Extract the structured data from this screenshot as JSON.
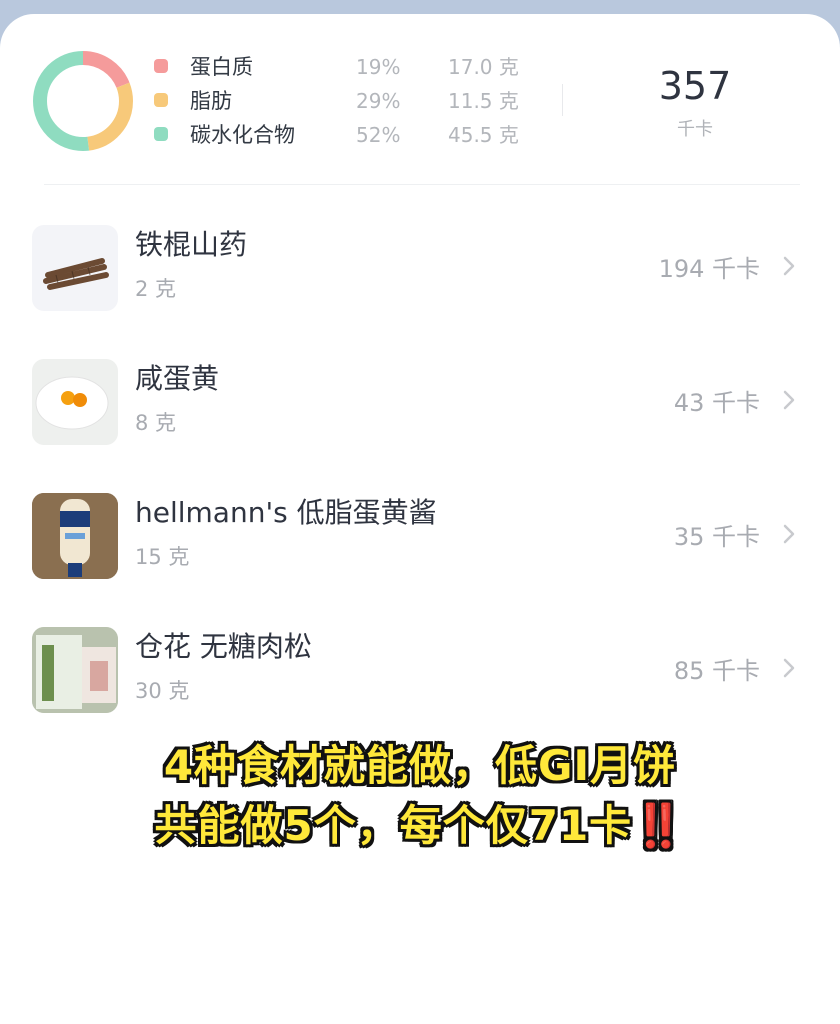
{
  "summary": {
    "macros": [
      {
        "name": "蛋白质",
        "percent": "19%",
        "grams": "17.0 克",
        "color": "#f59b9b"
      },
      {
        "name": "脂肪",
        "percent": "29%",
        "grams": "11.5 克",
        "color": "#f7c97a"
      },
      {
        "name": "碳水化合物",
        "percent": "52%",
        "grams": "45.5 克",
        "color": "#8fdcc0"
      }
    ],
    "total_kcal": "357",
    "total_unit": "千卡"
  },
  "foods": [
    {
      "name": "铁棍山药",
      "weight": "2  克",
      "kcal": "194 千卡",
      "icon": "yam-thumbnail"
    },
    {
      "name": "咸蛋黄",
      "weight": "8 克",
      "kcal": "43 千卡",
      "icon": "egg-yolk-thumbnail"
    },
    {
      "name": "hellmann's 低脂蛋黄酱",
      "weight": "15 克",
      "kcal": "35 千卡",
      "icon": "mayonnaise-thumbnail"
    },
    {
      "name": "仓花 无糖肉松",
      "weight": "30 克",
      "kcal": "85 千卡",
      "icon": "meat-floss-thumbnail"
    }
  ],
  "caption": {
    "line1": "4种食材就能做，低GI月饼",
    "line2": "共能做5个，每个仅71卡",
    "emphasis": "‼️"
  }
}
